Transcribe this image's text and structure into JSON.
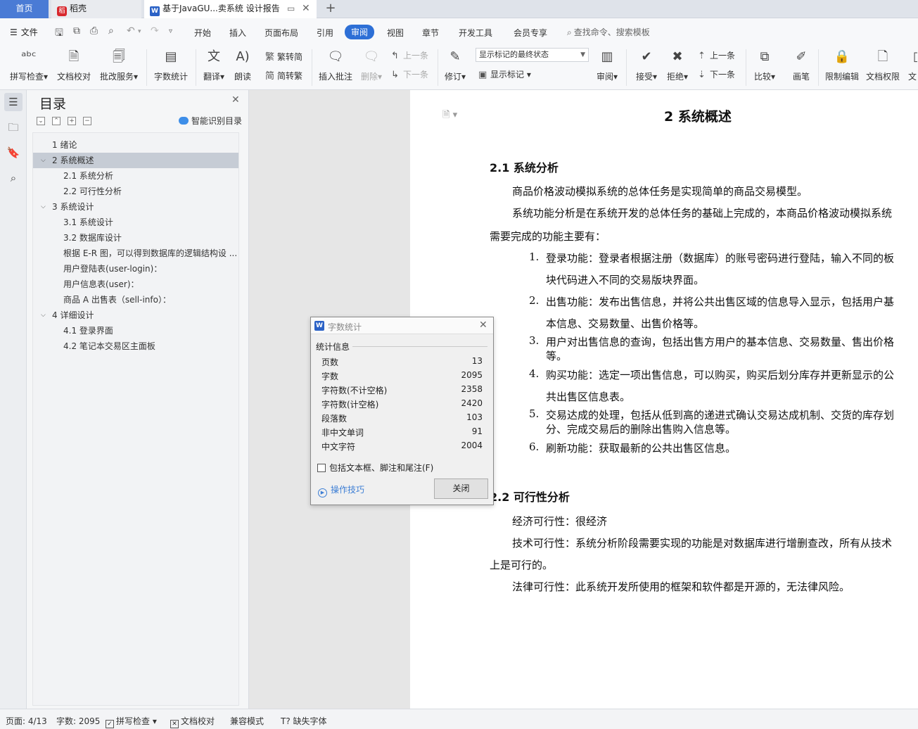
{
  "tabs": {
    "home": "首页",
    "daoke": "稻壳",
    "doc": "基于JavaGU...卖系统 设计报告"
  },
  "menubar": {
    "file": "文件",
    "items": [
      "开始",
      "插入",
      "页面布局",
      "引用",
      "审阅",
      "视图",
      "章节",
      "开发工具",
      "会员专享"
    ],
    "active": "审阅",
    "search": "查找命令、搜索模板"
  },
  "ribbon": {
    "spell": "拼写检查",
    "proofread": "文档校对",
    "revise_service": "批改服务",
    "word_count": "字数统计",
    "translate": "翻译",
    "read_aloud": "朗读",
    "to_traditional": "繁转简",
    "to_simplified": "简转繁",
    "insert_comment": "插入批注",
    "delete": "删除",
    "prev_comment": "上一条",
    "next_comment": "下一条",
    "track": "修订",
    "markup_state": "显示标记的最终状态",
    "show_markup": "显示标记",
    "review": "审阅",
    "accept": "接受",
    "reject": "拒绝",
    "prev_change": "上一条",
    "next_change": "下一条",
    "compare": "比较",
    "ink": "画笔",
    "restrict": "限制编辑",
    "permission": "文档权限",
    "more": "文"
  },
  "toc": {
    "title": "目录",
    "smart": "智能识别目录",
    "items": [
      {
        "text": "1  绪论",
        "arrow": ""
      },
      {
        "text": "2  系统概述",
        "arrow": "⌵"
      },
      {
        "text": "2.1  系统分析",
        "arrow": ""
      },
      {
        "text": "2.2  可行性分析",
        "arrow": ""
      },
      {
        "text": "3  系统设计",
        "arrow": "⌵"
      },
      {
        "text": "3.1  系统设计",
        "arrow": ""
      },
      {
        "text": "3.2  数据库设计",
        "arrow": ""
      },
      {
        "text": "根据 E-R 图，可以得到数据库的逻辑结构设 ...",
        "arrow": ""
      },
      {
        "text": "用户登陆表(user-login)：",
        "arrow": ""
      },
      {
        "text": "用户信息表(user)：",
        "arrow": ""
      },
      {
        "text": "商品 A 出售表（sell-info）：",
        "arrow": ""
      },
      {
        "text": "4  详细设计",
        "arrow": "⌵"
      },
      {
        "text": "4.1  登录界面",
        "arrow": ""
      },
      {
        "text": "4.2  笔记本交易区主面板",
        "arrow": ""
      }
    ]
  },
  "document": {
    "chapter": "2  系统概述",
    "sec1": "2.1  系统分析",
    "p1": "商品价格波动模拟系统的总体任务是实现简单的商品交易模型。",
    "p2a": "系统功能分析是在系统开发的总体任务的基础上完成的，本商品价格波动模拟系统",
    "p2b": "需要完成的功能主要有：",
    "l1num": "1.",
    "l1a": "登录功能：登录者根据注册（数据库）的账号密码进行登陆，输入不同的板",
    "l1b": "块代码进入不同的交易版块界面。",
    "l2num": "2.",
    "l2a": "出售功能：发布出售信息，并将公共出售区域的信息导入显示，包括用户基",
    "l2b": "本信息、交易数量、出售价格等。",
    "l3num": "3.",
    "l3a": "用户对出售信息的查询，包括出售方用户的基本信息、交易数量、售出价格",
    "l3b": "等。",
    "l4num": "4.",
    "l4a": "购买功能：选定一项出售信息，可以购买，购买后划分库存并更新显示的公",
    "l4b": "共出售区信息表。",
    "l5num": "5.",
    "l5a": "交易达成的处理，包括从低到高的递进式确认交易达成机制、交货的库存划",
    "l5b": "分、完成交易后的删除出售购入信息等。",
    "l6num": "6.",
    "l6a": "刷新功能：获取最新的公共出售区信息。",
    "sec2": "2.2  可行性分析",
    "q1": "经济可行性：很经济",
    "q2a": "技术可行性：系统分析阶段需要实现的功能是对数据库进行增删查改，所有从技术",
    "q2b": "上是可行的。",
    "q3": "法律可行性：此系统开发所使用的框架和软件都是开源的，无法律风险。"
  },
  "dialog": {
    "title": "字数统计",
    "group": "统计信息",
    "stats": [
      {
        "label": "页数",
        "value": "13"
      },
      {
        "label": "字数",
        "value": "2095"
      },
      {
        "label": "字符数(不计空格)",
        "value": "2358"
      },
      {
        "label": "字符数(计空格)",
        "value": "2420"
      },
      {
        "label": "段落数",
        "value": "103"
      },
      {
        "label": "非中文单词",
        "value": "91"
      },
      {
        "label": "中文字符",
        "value": "2004"
      }
    ],
    "include": "包括文本框、脚注和尾注(F)",
    "tips": "操作技巧",
    "close": "关闭"
  },
  "status": {
    "page": "页面: 4/13",
    "words": "字数: 2095",
    "spell": "拼写检查",
    "proof": "文档校对",
    "compat": "兼容模式",
    "font": "缺失字体"
  },
  "colors": {
    "accent": "#2d6fd6",
    "home_tab": "#4a7bd5",
    "link": "#3e7fd5"
  }
}
